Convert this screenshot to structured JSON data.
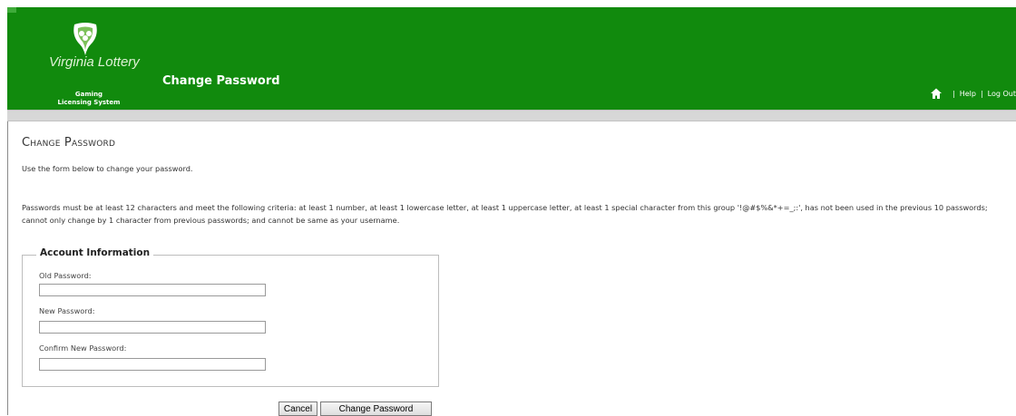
{
  "header": {
    "logo_text": "Virginia Lottery",
    "system_line1": "Gaming",
    "system_line2": "Licensing System",
    "title": "Change Password",
    "links": {
      "separator": "|",
      "help": "Help",
      "logout": "Log Out"
    }
  },
  "page": {
    "title": "Change Password",
    "intro": "Use the form below to change your password.",
    "rules": "Passwords must be at least 12 characters and meet the following criteria: at least 1 number, at least 1 lowercase letter, at least 1 uppercase letter, at least 1 special character from this group '!@#$%&*+=_;:', has not been used in the previous 10 passwords; cannot only change by 1 character from previous passwords; and cannot be same as your username."
  },
  "form": {
    "legend": "Account Information",
    "old_password": {
      "label": "Old Password:",
      "value": ""
    },
    "new_password": {
      "label": "New Password:",
      "value": ""
    },
    "confirm_password": {
      "label": "Confirm New Password:",
      "value": ""
    }
  },
  "buttons": {
    "cancel": "Cancel",
    "change": "Change Password"
  },
  "colors": {
    "header_green": "#118a0d",
    "gray_bar": "#d7d7d7",
    "text": "#333333"
  },
  "icons": {
    "logo": "virginia-lottery-clover-icon",
    "home": "home-icon"
  }
}
